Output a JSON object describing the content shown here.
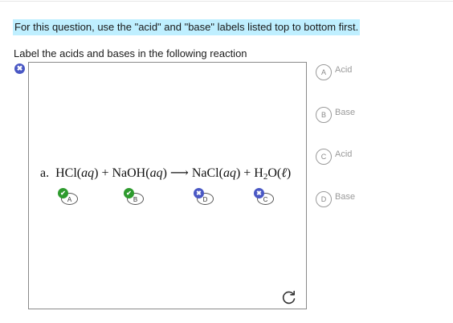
{
  "instruction": "For this question, use the \"acid\" and \"base\" labels listed top to bottom first.",
  "prompt": "Label the acids and bases in the following reaction",
  "equation": {
    "prefix": "a.",
    "r1": "HCl(",
    "r1_state": "aq",
    "r1_close": ")",
    "plus1": "+",
    "r2": "NaOH(",
    "r2_state": "aq",
    "r2_close": ")",
    "arrow": "⟶",
    "p1": "NaCl(",
    "p1_state": "aq",
    "p1_close": ")",
    "plus2": "+",
    "p2_h": "H",
    "p2_sub": "2",
    "p2_o": "O(",
    "p2_state": "ℓ",
    "p2_close": ")"
  },
  "targets": [
    {
      "letter": "A",
      "status": "correct",
      "status_icon": "check-icon"
    },
    {
      "letter": "B",
      "status": "correct",
      "status_icon": "check-icon"
    },
    {
      "letter": "D",
      "status": "incorrect",
      "status_icon": "close-icon"
    },
    {
      "letter": "C",
      "status": "incorrect",
      "status_icon": "close-icon"
    }
  ],
  "options": [
    {
      "letter": "A",
      "label": "Acid"
    },
    {
      "letter": "B",
      "label": "Base"
    },
    {
      "letter": "C",
      "label": "Acid"
    },
    {
      "letter": "D",
      "label": "Base"
    }
  ],
  "glyphs": {
    "check": "✔",
    "cross": "✖"
  },
  "colors": {
    "highlight": "#bfefff",
    "correct": "#2e9b2e",
    "incorrect": "#4a58c4"
  }
}
